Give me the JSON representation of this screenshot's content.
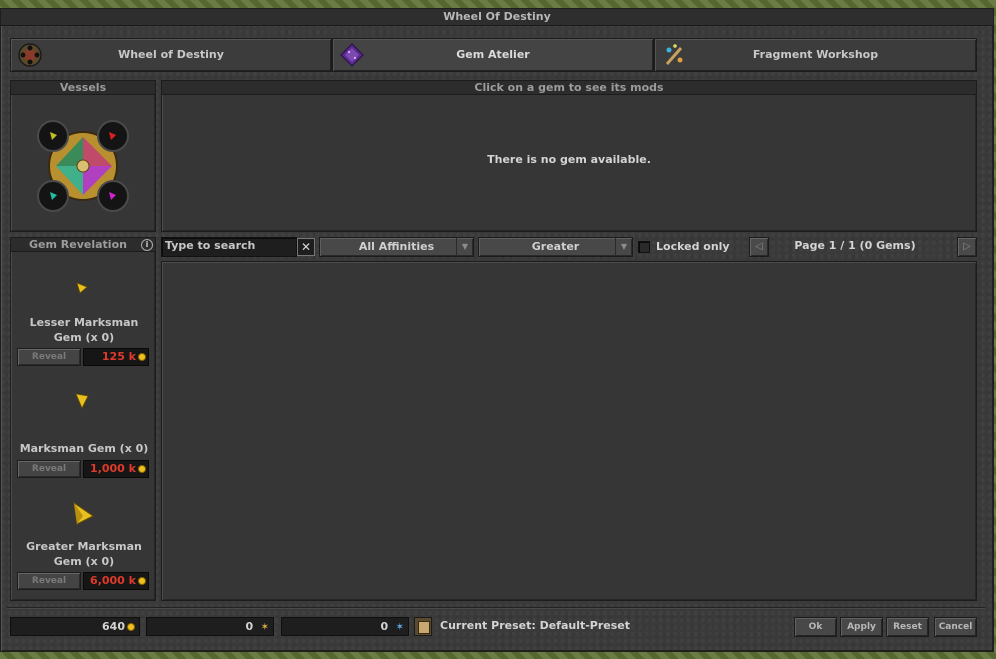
{
  "window": {
    "title": "Wheel Of Destiny"
  },
  "tabs": [
    {
      "label": "Wheel of Destiny",
      "icon": "wheel-icon"
    },
    {
      "label": "Gem Atelier",
      "icon": "gem-atelier-icon"
    },
    {
      "label": "Fragment Workshop",
      "icon": "fragment-workshop-icon"
    }
  ],
  "vessels": {
    "title": "Vessels"
  },
  "mods": {
    "title": "Click on a gem to see its mods",
    "empty_message": "There is no gem available."
  },
  "revelation": {
    "title": "Gem Revelation",
    "info_icon": "info-icon",
    "gems": [
      {
        "name_line1": "Lesser Marksman",
        "name_line2": "Gem (x 0)",
        "reveal_label": "Reveal",
        "cost": "125 k"
      },
      {
        "name_line1": "Marksman Gem (x 0)",
        "name_line2": "",
        "reveal_label": "Reveal",
        "cost": "1,000 k"
      },
      {
        "name_line1": "Greater Marksman",
        "name_line2": "Gem (x 0)",
        "reveal_label": "Reveal",
        "cost": "6,000 k"
      }
    ]
  },
  "filters": {
    "search_placeholder": "Type to search",
    "affinity_selected": "All Affinities",
    "quality_selected": "Greater",
    "locked_only_label": "Locked only",
    "page_info": "Page 1 / 1 (0 Gems)"
  },
  "footer": {
    "gold": "640",
    "lesser_fragments": "0",
    "greater_fragments": "0",
    "preset_label": "Current Preset: Default-Preset",
    "buttons": {
      "ok": "Ok",
      "apply": "Apply",
      "reset": "Reset",
      "cancel": "Cancel"
    }
  },
  "colors": {
    "cost_text": "#e03a2a",
    "gem_yellow": "#e8c020",
    "window_bg": "#3a3a3a"
  }
}
